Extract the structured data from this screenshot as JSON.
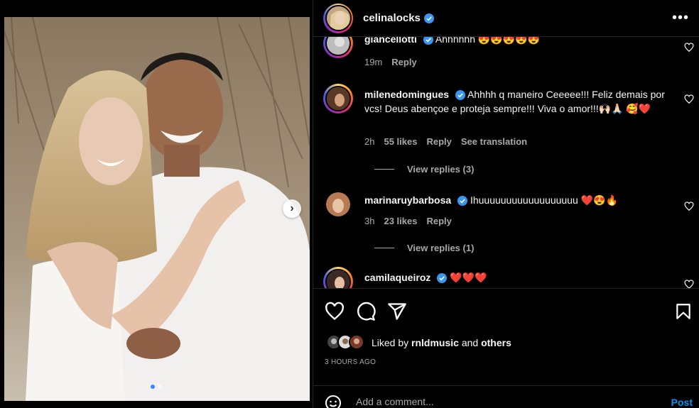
{
  "post": {
    "author": "celinalocks",
    "time_ago": "3 HOURS AGO",
    "liked_by_prefix": "Liked by ",
    "liked_by_user": "rnldmusic",
    "liked_by_and": " and ",
    "liked_by_others": "others"
  },
  "carousel": {
    "total": 2,
    "current": 1
  },
  "comments": [
    {
      "user": "giancellotti",
      "text": "Ahhhhhh 😍😍😍😍😍",
      "time": "19m",
      "likes": "",
      "reply": "Reply",
      "see_translation": ""
    },
    {
      "user": "milenedomingues",
      "text": "Ahhhh q maneiro Ceeeee!!! Feliz demais por vcs! Deus abençoe e proteja sempre!!! Viva o amor!!!🙌🏻🙏🏻 🥰❤️",
      "time": "2h",
      "likes": "55 likes",
      "reply": "Reply",
      "see_translation": "See translation",
      "view_replies": "View replies (3)"
    },
    {
      "user": "marinaruybarbosa",
      "text": "Ihuuuuuuuuuuuuuuuuuu ❤️😍🔥",
      "time": "3h",
      "likes": "23 likes",
      "reply": "Reply",
      "view_replies": "View replies (1)"
    },
    {
      "user": "camilaqueiroz",
      "text": "❤️❤️❤️"
    }
  ],
  "input": {
    "placeholder": "Add a comment...",
    "post_label": "Post"
  },
  "colors": {
    "accent": "#0095f6",
    "verified": "#3897f0",
    "like_red": "#ed4956",
    "bg": "#000000"
  }
}
